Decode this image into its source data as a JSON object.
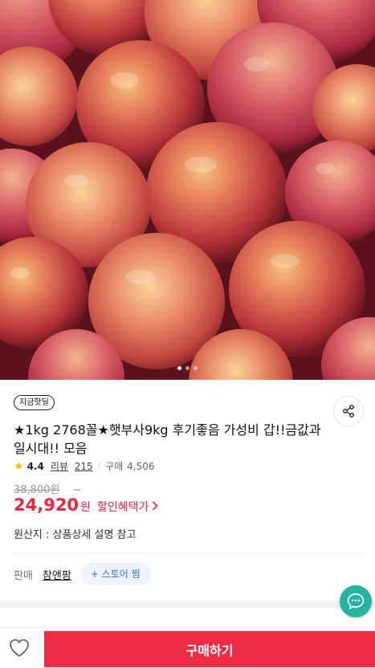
{
  "gallery": {
    "image_alt": "apples photo",
    "page_count": 3,
    "active_index": 0
  },
  "product": {
    "badge": "지금핫딜",
    "title": "★1kg 2768꼴★햇부사9kg 후기좋음 가성비 갑!!금값과일시대!! 모음",
    "rating": "4.4",
    "review_label": "리뷰",
    "review_count": "215",
    "purchase_label": "구매",
    "purchase_count": "4,506",
    "original_price": "38,800원",
    "tilde": "~",
    "price": "24,920",
    "price_unit": "원",
    "discount_link": "할인혜택가",
    "origin": "원산지 : 상품상세 설명 참고"
  },
  "seller": {
    "label": "판매",
    "name": "참앤팜",
    "favorite_label": "+ 스토어 찜"
  },
  "bottom_bar": {
    "buy_label": "구매하기"
  },
  "colors": {
    "accent": "#ee2d45",
    "price": "#f02440",
    "chat": "#25b3a2",
    "star": "#f6b800",
    "store_button_text": "#3a6fd8"
  },
  "icons": {
    "share": "share-icon",
    "star": "star-icon",
    "chat": "chat-icon",
    "heart": "heart-icon",
    "chevron": "chevron-right-icon"
  }
}
